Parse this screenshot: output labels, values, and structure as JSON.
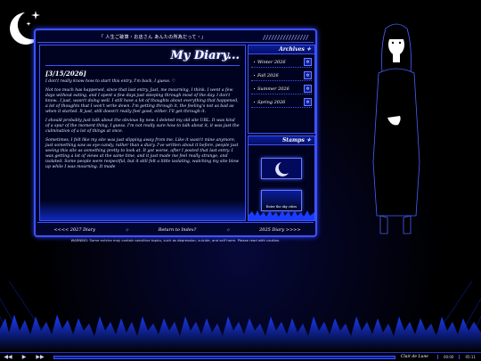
{
  "window": {
    "title": "「 人生ご破算・お店さん あんたの所為だって・」",
    "stripes": "////////////////"
  },
  "diary": {
    "title": "My Diary...",
    "entry_date": "[3/15/2026]",
    "paragraphs": [
      "I don't really know how to start this entry. I'm back, I guess. ♡",
      "Not too much has happened, since that last entry. Just, me mourning, I think. I went a few days without eating, and I spent a few days just sleeping through most of the day. I don't know.. I just, wasn't doing well. I still have a lot of thoughts about everything that happened, a lot of thoughts that I won't write down. I'm getting through it, the feeling's not as bad as when it started. It just, still doesn't really feel good, either. I'll get through it.",
      "I should probably just talk about the obvious by now. I deleted my old site URL. It was kind of a spur of the moment thing, I guess. I'm not really sure how to talk about it, it was just the culmination of a lot of things at once.",
      "Sometimes, I felt like my site was just slipping away from me. Like it wasn't mine anymore, just something saw as eye-candy, rather than a diary. I've written about it before, people just seeing this site as something pretty to look at. It got worse, after I posted that last entry. I was getting a lot of views at the same time, and it just made me feel really strange, and isolated. Some people were respectful, but it still felt a little isolating, watching my site blow up while I was mourning. It made"
    ]
  },
  "archives": {
    "title": "Archives ✧",
    "items": [
      {
        "label": "Winter 2026",
        "icon": "✲"
      },
      {
        "label": "Fall 2026",
        "icon": "✲"
      },
      {
        "label": "Summer 2026",
        "icon": "✲"
      },
      {
        "label": "Spring 2026",
        "icon": "✲"
      }
    ]
  },
  "stamps": {
    "title": "Stamps ✧",
    "stamp2_text": "Enter the sky cities"
  },
  "nav": {
    "prev": "<<<< 2027 Diary",
    "index": "Return to Index?",
    "next": "2025 Diary >>>>",
    "sep": "✧"
  },
  "warning": "WARNING: Some entries may contain sensitive topics, such as depression, suicide, and self harm. Please read with caution.",
  "player": {
    "prev": "◀◀",
    "play": "▶",
    "next": "▶▶",
    "song": "Clair de Lune",
    "elapsed": "00:00",
    "duration": "05:11"
  },
  "colors": {
    "accent": "#3c52ff",
    "panel": "#00052e",
    "background": "#000000"
  }
}
